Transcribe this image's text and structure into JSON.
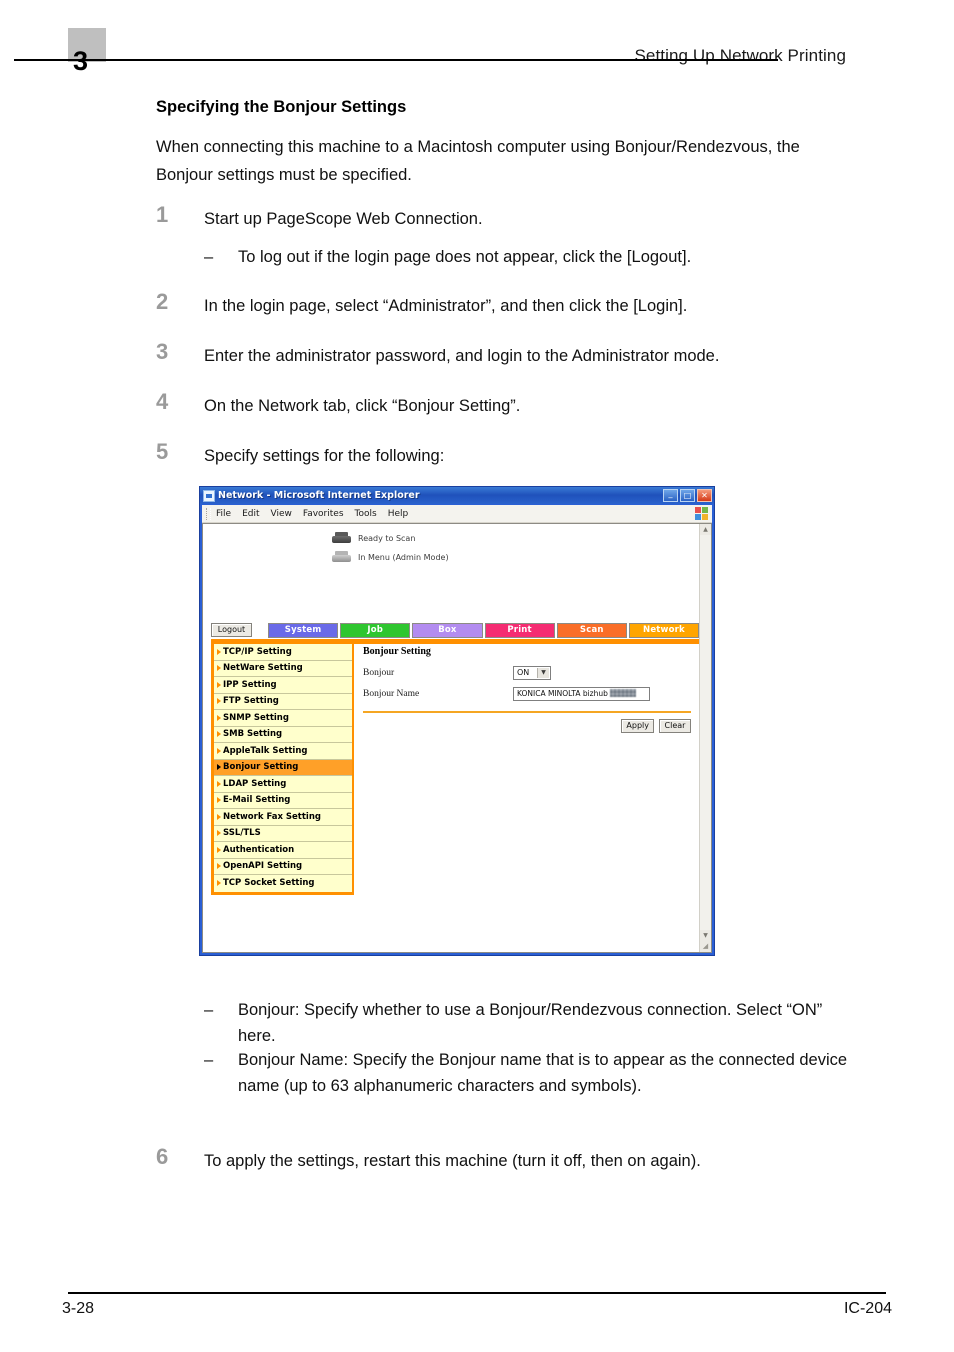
{
  "page": {
    "chapter_number": "3",
    "header_title": "Setting Up Network Printing",
    "footer_page": "3-28",
    "footer_code": "IC-204"
  },
  "content": {
    "section_title": "Specifying the Bonjour Settings",
    "intro": "When connecting this machine to a Macintosh computer using Bonjour/Rendezvous, the Bonjour settings must be specified.",
    "steps": [
      {
        "num": "1",
        "text": "Start up PageScope Web Connection."
      },
      {
        "num": "2",
        "text": "In the login page, select “Administrator”, and then click the [Login]."
      },
      {
        "num": "3",
        "text": "Enter the administrator password, and login to the Administrator mode."
      },
      {
        "num": "4",
        "text": "On the Network tab, click “Bonjour Setting”."
      },
      {
        "num": "5",
        "text": "Specify settings for the following:"
      },
      {
        "num": "6",
        "text": "To apply the settings, restart this machine (turn it off, then on again)."
      }
    ],
    "sub_step_1": "To log out if the login page does not appear, click the [Logout].",
    "bullet_bonjour": "Bonjour: Specify whether to use a Bonjour/Rendezvous connection. Select “ON” here.",
    "bullet_bonjour_name": "Bonjour Name: Specify the Bonjour name that is to appear as the connected device name (up to 63 alphanumeric characters and symbols).",
    "dash": "–"
  },
  "browser": {
    "title": "Network - Microsoft Internet Explorer",
    "menu": [
      "File",
      "Edit",
      "View",
      "Favorites",
      "Tools",
      "Help"
    ],
    "window_buttons": [
      "minimize-button",
      "maximize-button",
      "close-button"
    ]
  },
  "webpage": {
    "status": [
      {
        "icon": "printer-icon",
        "text": "Ready to Scan"
      },
      {
        "icon": "printer-icon",
        "text": "In Menu (Admin Mode)"
      }
    ],
    "logout_label": "Logout",
    "tabs": [
      {
        "label": "System",
        "color": "#6a6ae8"
      },
      {
        "label": "Job",
        "color": "#2fc62f"
      },
      {
        "label": "Box",
        "color": "#b38cf0"
      },
      {
        "label": "Print",
        "color": "#f52c72"
      },
      {
        "label": "Scan",
        "color": "#fa6e28"
      },
      {
        "label": "Network",
        "color": "#ffa500"
      }
    ],
    "active_tab": "Network",
    "sidebar": [
      {
        "label": "TCP/IP Setting",
        "active": false
      },
      {
        "label": "NetWare Setting",
        "active": false
      },
      {
        "label": "IPP Setting",
        "active": false
      },
      {
        "label": "FTP Setting",
        "active": false
      },
      {
        "label": "SNMP Setting",
        "active": false
      },
      {
        "label": "SMB Setting",
        "active": false
      },
      {
        "label": "AppleTalk Setting",
        "active": false
      },
      {
        "label": "Bonjour Setting",
        "active": true
      },
      {
        "label": "LDAP Setting",
        "active": false
      },
      {
        "label": "E-Mail Setting",
        "active": false
      },
      {
        "label": "Network Fax Setting",
        "active": false
      },
      {
        "label": "SSL/TLS",
        "active": false
      },
      {
        "label": "Authentication",
        "active": false
      },
      {
        "label": "OpenAPI Setting",
        "active": false
      },
      {
        "label": "TCP Socket Setting",
        "active": false
      }
    ],
    "panel": {
      "title": "Bonjour Setting",
      "bonjour_label": "Bonjour",
      "bonjour_value": "ON",
      "bonjour_name_label": "Bonjour Name",
      "bonjour_name_value": "KONICA MINOLTA bizhub ",
      "apply_label": "Apply",
      "clear_label": "Clear"
    },
    "accent_color": "#ff9000",
    "highlight_color": "#ffa028",
    "menu_bg_color": "#ffffcc"
  }
}
